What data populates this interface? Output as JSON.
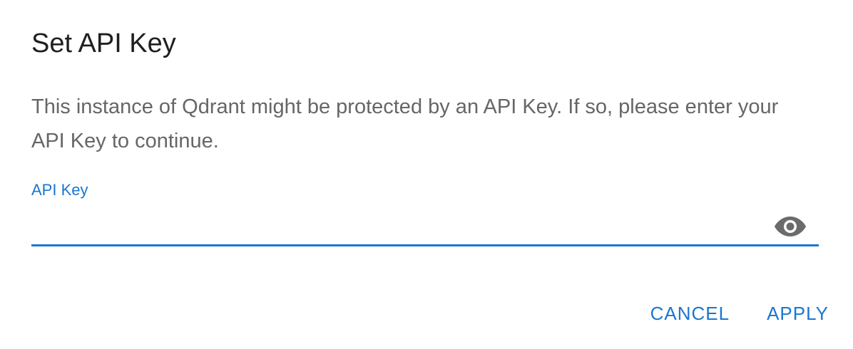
{
  "dialog": {
    "title": "Set API Key",
    "description": "This instance of Qdrant might be protected by an API Key. If so, please enter your API Key to continue.",
    "field": {
      "label": "API Key",
      "value": "",
      "placeholder": "",
      "toggle_icon": "eye-icon"
    },
    "actions": {
      "cancel_label": "CANCEL",
      "apply_label": "APPLY"
    }
  },
  "colors": {
    "accent": "#1976d2",
    "title": "#1f1f1f",
    "body_text": "#666666",
    "icon": "#6b6b6b"
  }
}
